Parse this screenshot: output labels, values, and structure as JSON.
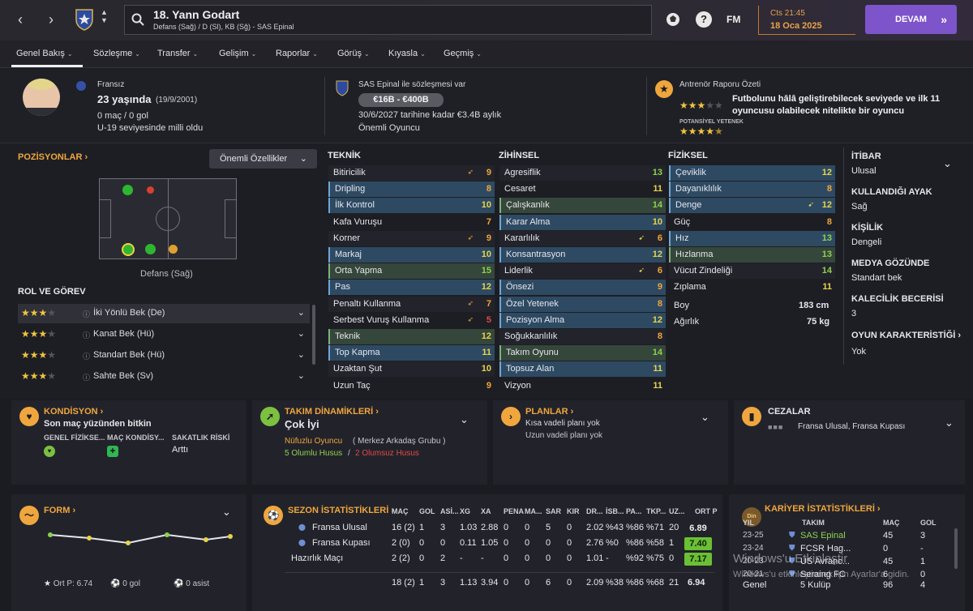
{
  "topbar": {
    "player_title": "18. Yann Godart",
    "player_sub": "Defans (Sağ) / D (Sl), KB (Sğ) - SAS Epinal",
    "time": "Cts 21:45",
    "date": "18 Oca 2025",
    "fm_label": "FM",
    "help_label": "?",
    "continue_label": "DEVAM"
  },
  "tabs": [
    {
      "label": "Genel Bakış"
    },
    {
      "label": "Sözleşme"
    },
    {
      "label": "Transfer"
    },
    {
      "label": "Gelişim"
    },
    {
      "label": "Raporlar"
    },
    {
      "label": "Görüş"
    },
    {
      "label": "Kıyasla"
    },
    {
      "label": "Geçmiş"
    }
  ],
  "bio": {
    "nationality": "Fransız",
    "age": "23 yaşında",
    "dob": "(19/9/2001)",
    "apps": "0 maç / 0 gol",
    "intl": "U-19 seviyesinde milli oldu"
  },
  "contract": {
    "club_line": "SAS Epinal ile sözleşmesi var",
    "value_range": "€16B - €400B",
    "until": "30/6/2027 tarihine kadar €3.4B aylık",
    "status": "Önemli Oyuncu"
  },
  "coach_report": {
    "title": "Antrenör Raporu Özeti",
    "text": "Futbolunu hâlâ geliştirebilecek seviyede ve ilk 11 oyuncusu olabilecek nitelikte bir oyuncu",
    "potential_label": "POTANSİYEL YETENEK",
    "ability_stars": 3,
    "potential_stars": 4.5
  },
  "positions": {
    "title": "POZİSYONLAR",
    "dropdown": "Önemli Özellikler",
    "position_label": "Defans (Sağ)",
    "role_title": "ROL VE GÖREV",
    "roles": [
      {
        "name": "İki Yönlü Bek (De)",
        "stars": 3
      },
      {
        "name": "Kanat Bek (Hü)",
        "stars": 3
      },
      {
        "name": "Standart Bek (Hü)",
        "stars": 3
      },
      {
        "name": "Sahte Bek (Sv)",
        "stars": 3
      }
    ]
  },
  "technical": {
    "title": "TEKNİK",
    "rows": [
      {
        "name": "Bitiricilik",
        "value": "9"
      },
      {
        "name": "Dripling",
        "value": "8"
      },
      {
        "name": "İlk Kontrol",
        "value": "10"
      },
      {
        "name": "Kafa Vuruşu",
        "value": "7"
      },
      {
        "name": "Korner",
        "value": "9"
      },
      {
        "name": "Markaj",
        "value": "10"
      },
      {
        "name": "Orta Yapma",
        "value": "15"
      },
      {
        "name": "Pas",
        "value": "12"
      },
      {
        "name": "Penaltı Kullanma",
        "value": "7"
      },
      {
        "name": "Serbest Vuruş Kullanma",
        "value": "5"
      },
      {
        "name": "Teknik",
        "value": "12"
      },
      {
        "name": "Top Kapma",
        "value": "11"
      },
      {
        "name": "Uzaktan Şut",
        "value": "10"
      },
      {
        "name": "Uzun Taç",
        "value": "9"
      }
    ]
  },
  "mental": {
    "title": "ZİHİNSEL",
    "rows": [
      {
        "name": "Agresiflik",
        "value": "13"
      },
      {
        "name": "Cesaret",
        "value": "11"
      },
      {
        "name": "Çalışkanlık",
        "value": "14"
      },
      {
        "name": "Karar Alma",
        "value": "10"
      },
      {
        "name": "Kararlılık",
        "value": "6"
      },
      {
        "name": "Konsantrasyon",
        "value": "12"
      },
      {
        "name": "Liderlik",
        "value": "6"
      },
      {
        "name": "Önsezi",
        "value": "9"
      },
      {
        "name": "Özel Yetenek",
        "value": "8"
      },
      {
        "name": "Pozisyon Alma",
        "value": "12"
      },
      {
        "name": "Soğukkanlılık",
        "value": "8"
      },
      {
        "name": "Takım Oyunu",
        "value": "14"
      },
      {
        "name": "Topsuz Alan",
        "value": "11"
      },
      {
        "name": "Vizyon",
        "value": "11"
      }
    ]
  },
  "physical": {
    "title": "FİZİKSEL",
    "rows": [
      {
        "name": "Çeviklik",
        "value": "12"
      },
      {
        "name": "Dayanıklılık",
        "value": "8"
      },
      {
        "name": "Denge",
        "value": "12"
      },
      {
        "name": "Güç",
        "value": "8"
      },
      {
        "name": "Hız",
        "value": "13"
      },
      {
        "name": "Hızlanma",
        "value": "13"
      },
      {
        "name": "Vücut Zindeliği",
        "value": "14"
      },
      {
        "name": "Zıplama",
        "value": "11"
      }
    ],
    "height_label": "Boy",
    "height": "183 cm",
    "weight_label": "Ağırlık",
    "weight": "75 kg"
  },
  "side_info": [
    {
      "label": "İTİBAR",
      "value": "Ulusal"
    },
    {
      "label": "KULLANDIĞI AYAK",
      "value": "Sağ"
    },
    {
      "label": "KİŞİLİK",
      "value": "Dengeli"
    },
    {
      "label": "MEDYA GÖZÜNDE",
      "value": "Standart bek"
    },
    {
      "label": "KALECİLİK BECERİSİ",
      "value": "3"
    },
    {
      "label": "OYUN KARAKTERİSTİĞİ",
      "value": "Yok"
    }
  ],
  "condition": {
    "title": "KONDİSYON",
    "text": "Son maç yüzünden bitkin",
    "col1": "GENEL FİZİKSE...",
    "col2": "MAÇ KONDİSY...",
    "col3": "SAKATLIK RİSKİ",
    "risk": "Arttı"
  },
  "dynamics": {
    "title": "TAKIM DİNAMİKLERİ",
    "value": "Çok İyi",
    "role": "Nüfuzlu Oyuncu",
    "group": "( Merkez Arkadaş Grubu )",
    "positive": "5 Olumlu Husus",
    "sep": "/",
    "negative": "2 Olumsuz Husus"
  },
  "plans": {
    "title": "PLANLAR",
    "short": "Kısa vadeli planı yok",
    "long": "Uzun vadeli planı yok"
  },
  "penalties": {
    "title": "CEZALAR",
    "text": "Fransa Ulusal, Fransa Kupası"
  },
  "form": {
    "title": "FORM",
    "avg": "Ort P: 6.74",
    "goals": "0 gol",
    "assists": "0 asist"
  },
  "season": {
    "title": "SEZON İSTATİSTİKLERİ",
    "headers": [
      "MAÇ",
      "GOL",
      "ASİ...",
      "XG",
      "XA",
      "PENA",
      "MA...",
      "SAR",
      "KIR",
      "DR...",
      "İSB...",
      "PA...",
      "TKP...",
      "UZ...",
      "ORT P"
    ],
    "rows": [
      {
        "comp": "Fransa Ulusal",
        "cells": [
          "16 (2)",
          "1",
          "3",
          "1.03",
          "2.88",
          "0",
          "0",
          "5",
          "0",
          "2.02",
          "%43",
          "%86",
          "%71",
          "20"
        ],
        "rating": "6.89"
      },
      {
        "comp": "Fransa Kupası",
        "cells": [
          "2 (0)",
          "0",
          "0",
          "0.11",
          "1.05",
          "0",
          "0",
          "0",
          "0",
          "2.76",
          "%0",
          "%86",
          "%58",
          "1"
        ],
        "rating": "7.40"
      },
      {
        "comp": "Hazırlık Maçı",
        "cells": [
          "2 (2)",
          "0",
          "2",
          "-",
          "-",
          "0",
          "0",
          "0",
          "0",
          "1.01",
          "-",
          "%92",
          "%75",
          "0"
        ],
        "rating": "7.17"
      }
    ],
    "total": {
      "cells": [
        "18 (2)",
        "1",
        "3",
        "1.13",
        "3.94",
        "0",
        "0",
        "6",
        "0",
        "2.09",
        "%38",
        "%86",
        "%68",
        "21"
      ],
      "rating": "6.94"
    }
  },
  "career": {
    "title": "KARİYER İSTATİSTİKLERİ",
    "headers": [
      "YIL",
      "TAKIM",
      "MAÇ",
      "GOL"
    ],
    "rows": [
      {
        "year": "23-25",
        "team": "SAS Epinal",
        "apps": "45",
        "goals": "3"
      },
      {
        "year": "23-24",
        "team": "FCSR Hag...",
        "apps": "0",
        "goals": "-"
      },
      {
        "year": "20-23",
        "team": "US Avranc...",
        "apps": "45",
        "goals": "1"
      },
      {
        "year": "20-21",
        "team": "Seraing FC",
        "apps": "6",
        "goals": "0"
      }
    ],
    "total": {
      "label": "Genel",
      "team": "5 Kulüp",
      "apps": "96",
      "goals": "4"
    }
  },
  "watermark": {
    "line1": "Windows'u Etkinleştir",
    "line2": "Windows'u etkinleştirmek için Ayarlar'a gidin."
  }
}
